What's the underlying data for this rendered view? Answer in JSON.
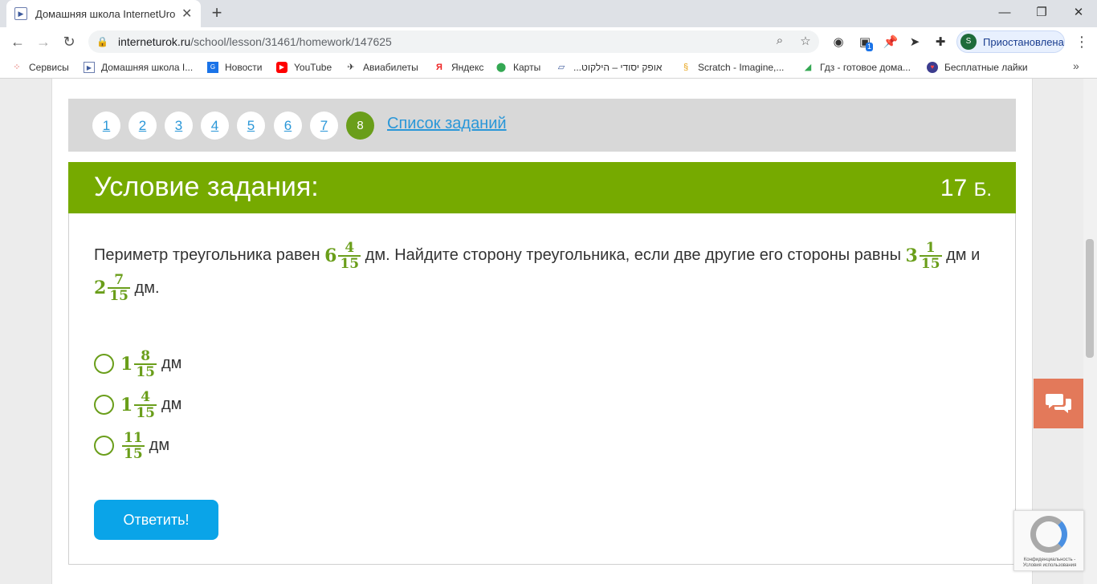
{
  "browser": {
    "tab_title": "Домашняя школа InternetUrok.r",
    "url_host": "interneturok.ru",
    "url_path": "/school/lesson/31461/homework/147625",
    "profile_initial": "S",
    "profile_label": "Приостановлена",
    "ext_badge": "1",
    "bookmarks": [
      "Сервисы",
      "Домашняя школа I...",
      "Новости",
      "YouTube",
      "Авиабилеты",
      "Яндекс",
      "Карты",
      "...אופק יסודי – הילקוט",
      "Scratch - Imagine,...",
      "Гдз - готовое дома...",
      "Бесплатные лайки"
    ]
  },
  "nav": {
    "questions": [
      "1",
      "2",
      "3",
      "4",
      "5",
      "6",
      "7",
      "8"
    ],
    "active": "8",
    "task_list": "Список заданий"
  },
  "task": {
    "title": "Условие задания:",
    "points_value": "17",
    "points_unit": "Б.",
    "text_parts": [
      "Периметр треугольника равен",
      "дм. Найдите сторону треугольника, если две другие его стороны равны",
      "дм и",
      "дм."
    ],
    "perimeter": {
      "whole": "6",
      "num": "4",
      "den": "15"
    },
    "side1": {
      "whole": "3",
      "num": "1",
      "den": "15"
    },
    "side2": {
      "whole": "2",
      "num": "7",
      "den": "15"
    },
    "options": [
      {
        "whole": "1",
        "num": "8",
        "den": "15",
        "unit": "дм"
      },
      {
        "whole": "1",
        "num": "4",
        "den": "15",
        "unit": "дм"
      },
      {
        "whole": "",
        "num": "11",
        "den": "15",
        "unit": "дм"
      }
    ],
    "submit_label": "Ответить!"
  },
  "recaptcha": {
    "text": "Конфиденциальность - Условия использования"
  },
  "colors": {
    "accent_green": "#76aa00",
    "link_blue": "#2a97d8",
    "button_blue": "#0aa4e8",
    "chat_orange": "#e3795a"
  }
}
